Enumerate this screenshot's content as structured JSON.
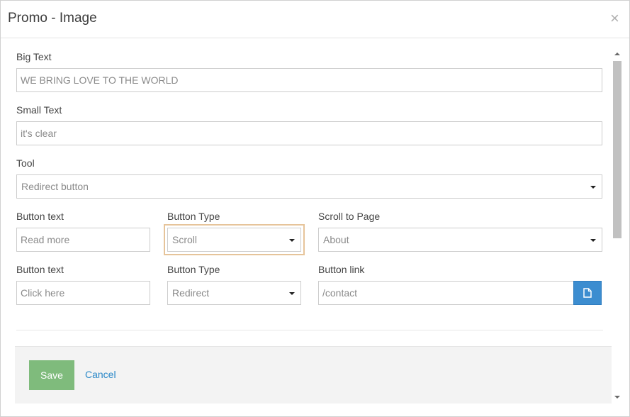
{
  "dialog": {
    "title": "Promo - Image",
    "close_glyph": "×"
  },
  "form": {
    "big_text": {
      "label": "Big Text",
      "value": "WE BRING LOVE TO THE WORLD"
    },
    "small_text": {
      "label": "Small Text",
      "value": "it's clear"
    },
    "tool": {
      "label": "Tool",
      "value": "Redirect button"
    },
    "row1": {
      "button_text": {
        "label": "Button text",
        "value": "Read more"
      },
      "button_type": {
        "label": "Button Type",
        "value": "Scroll"
      },
      "target": {
        "label": "Scroll to Page",
        "value": "About"
      }
    },
    "row2": {
      "button_text": {
        "label": "Button text",
        "value": "Click here"
      },
      "button_type": {
        "label": "Button Type",
        "value": "Redirect"
      },
      "target": {
        "label": "Button link",
        "value": "/contact"
      }
    }
  },
  "footer": {
    "save_label": "Save",
    "cancel_label": "Cancel"
  },
  "icons": {
    "close": "close-icon",
    "file": "file-icon",
    "dropdown": "caret-down-icon"
  },
  "colors": {
    "save_button": "#7fbb7c",
    "cancel_link": "#2a88c8",
    "file_button": "#3c8dd0",
    "focus_highlight": "#e6c49a"
  }
}
